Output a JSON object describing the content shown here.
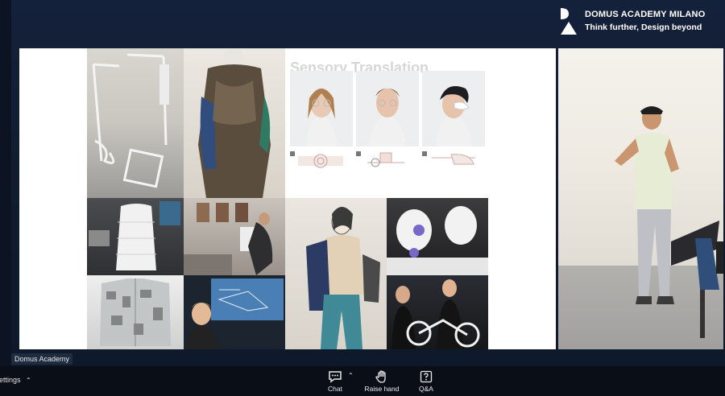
{
  "brand": {
    "name": "DOMUS ACADEMY MILANO",
    "tagline": "Think further, Design beyond"
  },
  "slide": {
    "title": "Sensory Translation"
  },
  "participant": {
    "name": "Domus Academy"
  },
  "toolbar": {
    "settings_label": "Settings",
    "chat_label": "Chat",
    "raise_hand_label": "Raise hand",
    "qa_label": "Q&A"
  }
}
